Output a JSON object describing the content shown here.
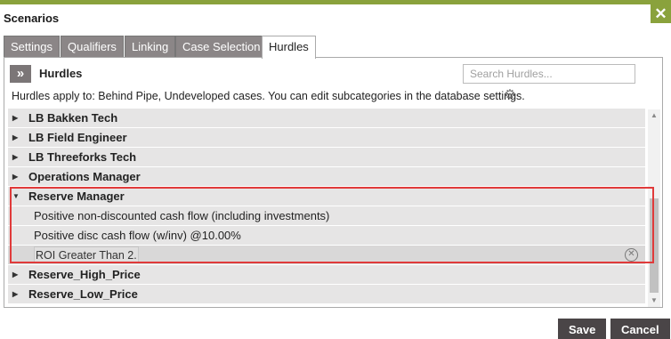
{
  "window": {
    "title": "Scenarios",
    "close_glyph": "✕"
  },
  "tabs": [
    {
      "label": "Settings"
    },
    {
      "label": "Qualifiers"
    },
    {
      "label": "Linking"
    },
    {
      "label": "Case Selection"
    },
    {
      "label": "Hurdles",
      "active": true
    }
  ],
  "hurdles": {
    "toggle_glyph": "»",
    "title": "Hurdles",
    "search_placeholder": "Search Hurdles...",
    "info_text": "Hurdles apply to: Behind Pipe, Undeveloped cases.  You can edit subcategories in the database settings."
  },
  "tree": [
    {
      "label": "LB Bakken Tech",
      "expanded": false
    },
    {
      "label": "LB Field Engineer",
      "expanded": false
    },
    {
      "label": "LB Threeforks Tech",
      "expanded": false
    },
    {
      "label": "Operations Manager",
      "expanded": false
    },
    {
      "label": "Reserve Manager",
      "expanded": true,
      "children": [
        {
          "label": "Positive non-discounted cash flow (including investments)"
        },
        {
          "label": "Positive disc cash flow  (w/inv) @10.00%"
        },
        {
          "label": "ROI Greater Than 2.00",
          "editing": true
        }
      ]
    },
    {
      "label": "Reserve_High_Price",
      "expanded": false
    },
    {
      "label": "Reserve_Low_Price",
      "expanded": false
    }
  ],
  "glyphs": {
    "collapsed": "▶",
    "expanded": "▼",
    "gear": "⚙",
    "clear": "✕",
    "scroll_up": "▲",
    "scroll_down": "▼"
  },
  "buttons": {
    "save": "Save",
    "cancel": "Cancel"
  },
  "colors": {
    "accent": "#8aa23c",
    "highlight": "#e03a3a",
    "tab_inactive": "#8b8687",
    "button": "#4a4547"
  }
}
